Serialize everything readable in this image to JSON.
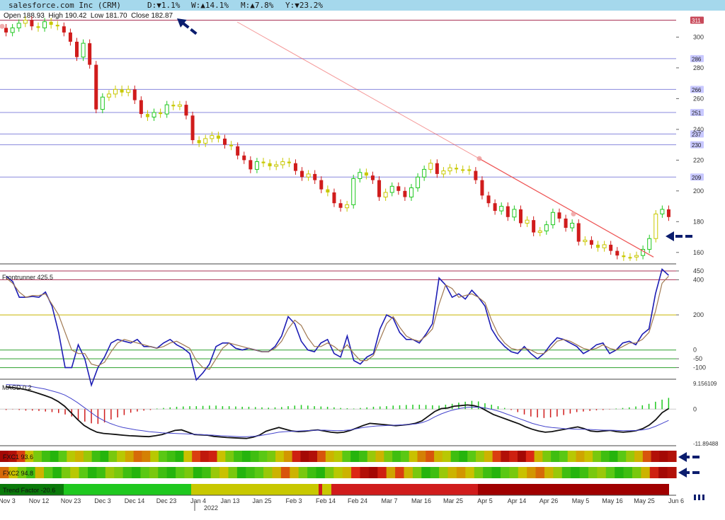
{
  "header": {
    "title": "salesforce.com Inc (CRM)",
    "day": "D:▼1.1%",
    "week": "W:▲14.1%",
    "month": "M:▲7.8%",
    "year": "Y:▼23.2%",
    "ohlc": "Open 188.93  High 190.42  Low 181.70  Close 182.87"
  },
  "colors": {
    "up": "#1fc81f",
    "down": "#d01c1c",
    "neutral": "#c8c800",
    "frontrunner": "#1c1cb4",
    "signal": "#a07850",
    "macd": "#111111",
    "macd_signal": "#4444cc",
    "level_line": "#8888dd",
    "trend_line": "#ee5555"
  },
  "chart_data": [
    {
      "type": "candlestick",
      "title": "salesforce.com Inc (CRM)",
      "x_ticks": [
        "Nov 3",
        "Nov 12",
        "Nov 23",
        "Dec 3",
        "Dec 14",
        "Dec 23",
        "Jan 4",
        "Jan 13",
        "Jan 25",
        "Feb 3",
        "Feb 14",
        "Feb 24",
        "Mar 7",
        "Mar 16",
        "Mar 25",
        "Apr 5",
        "Apr 14",
        "Apr 26",
        "May 5",
        "May 16",
        "May 25",
        "Jun 6"
      ],
      "year_label": "2022",
      "y_ticks": [
        160,
        180,
        200,
        220,
        240,
        260,
        280,
        300
      ],
      "level_labels": [
        311,
        286,
        266,
        251,
        237,
        230,
        209
      ],
      "ylim": [
        153,
        314
      ],
      "close": [
        303,
        306,
        309,
        311,
        307,
        306,
        310,
        308,
        307,
        303,
        297,
        287,
        296,
        282,
        253,
        261,
        263,
        266,
        264,
        266,
        259,
        250,
        248,
        251,
        250,
        256,
        255,
        256,
        249,
        233,
        231,
        234,
        236,
        234,
        230,
        229,
        223,
        220,
        214,
        219,
        218,
        216,
        217,
        219,
        218,
        213,
        209,
        211,
        207,
        201,
        199,
        192,
        189,
        191,
        208,
        212,
        210,
        207,
        196,
        199,
        203,
        200,
        196,
        202,
        209,
        214,
        218,
        211,
        213,
        215,
        214,
        214,
        213,
        207,
        197,
        192,
        187,
        190,
        183,
        188,
        179,
        181,
        173,
        174,
        178,
        186,
        182,
        176,
        179,
        167,
        168,
        165,
        163,
        165,
        161,
        158,
        157,
        157,
        158,
        162,
        169,
        185,
        188,
        183
      ],
      "up_color_count": [
        2,
        4,
        6,
        7
      ],
      "trend_line_from": [
        311,
        "Nov 3"
      ],
      "trend_line_to": [
        157,
        "Jun 1"
      ]
    },
    {
      "type": "line",
      "title": "Frontrunner 425.5",
      "y_ticks": [
        450,
        400,
        200,
        -50,
        -100
      ],
      "ylim": [
        -150,
        470
      ],
      "series": [
        {
          "name": "Frontrunner",
          "values": [
            420,
            390,
            300,
            300,
            305,
            300,
            330,
            250,
            100,
            -100,
            -100,
            30,
            -50,
            -200,
            -100,
            -40,
            40,
            60,
            50,
            40,
            60,
            20,
            20,
            10,
            40,
            60,
            30,
            10,
            -20,
            -170,
            -130,
            -80,
            20,
            40,
            40,
            10,
            0,
            10,
            0,
            -10,
            -10,
            20,
            80,
            190,
            150,
            50,
            0,
            -10,
            40,
            60,
            -20,
            -40,
            80,
            -60,
            -80,
            -40,
            -20,
            120,
            200,
            180,
            100,
            60,
            60,
            40,
            90,
            150,
            410,
            370,
            300,
            320,
            290,
            340,
            300,
            250,
            120,
            60,
            20,
            -10,
            -20,
            20,
            -20,
            -50,
            -20,
            30,
            70,
            60,
            40,
            20,
            -20,
            0,
            30,
            40,
            -20,
            0,
            40,
            50,
            30,
            90,
            120,
            320,
            460,
            425
          ],
          "color": "#1c1cb4"
        },
        {
          "name": "Signal",
          "values": [
            410,
            380,
            330,
            300,
            310,
            310,
            320,
            260,
            200,
            100,
            0,
            -20,
            -20,
            -80,
            -90,
            -70,
            -10,
            40,
            60,
            50,
            40,
            30,
            20,
            10,
            20,
            40,
            50,
            30,
            10,
            -60,
            -100,
            -110,
            -50,
            10,
            40,
            30,
            20,
            10,
            0,
            -10,
            -10,
            10,
            50,
            120,
            170,
            140,
            70,
            20,
            20,
            40,
            20,
            -10,
            30,
            -20,
            -60,
            -60,
            -30,
            60,
            150,
            190,
            130,
            80,
            60,
            50,
            80,
            120,
            260,
            370,
            350,
            300,
            310,
            320,
            300,
            270,
            170,
            90,
            40,
            10,
            0,
            10,
            0,
            -20,
            -20,
            10,
            50,
            60,
            50,
            30,
            10,
            0,
            10,
            30,
            10,
            0,
            20,
            40,
            40,
            60,
            100,
            220,
            380,
            420
          ],
          "color": "#a07850"
        }
      ]
    },
    {
      "type": "bar+line",
      "title": "MACD 0.2",
      "y_ticks": [
        "9.156109",
        "0",
        "-11.89488"
      ],
      "ylim": [
        -11.89,
        9.16
      ],
      "histogram": [
        -0.3,
        -0.1,
        -0.3,
        -0.5,
        -0.5,
        -0.6,
        -0.8,
        -1.0,
        -1.3,
        -1.8,
        -2.5,
        -3.5,
        -4.2,
        -4.8,
        -5.0,
        -4.5,
        -3.5,
        -2.8,
        -2.0,
        -1.2,
        -0.8,
        -0.5,
        -0.3,
        0.2,
        0.4,
        0.6,
        0.8,
        0.9,
        1.0,
        1.0,
        1.1,
        1.2,
        1.2,
        1.0,
        1.0,
        0.9,
        0.8,
        0.8,
        0.7,
        0.6,
        0.5,
        0.6,
        0.7,
        1.0,
        1.2,
        1.4,
        1.2,
        1.0,
        0.9,
        0.8,
        0.6,
        0.4,
        0.3,
        0.2,
        0.4,
        0.6,
        0.8,
        0.9,
        1.0,
        1.2,
        1.3,
        1.4,
        1.5,
        1.5,
        1.4,
        1.3,
        1.2,
        1.5,
        1.8,
        2.2,
        2.5,
        2.8,
        2.6,
        2.0,
        1.5,
        1.0,
        0.4,
        -0.3,
        -1.0,
        -1.8,
        -2.5,
        -2.8,
        -3.0,
        -2.8,
        -2.5,
        -2.0,
        -1.5,
        -1.0,
        -0.8,
        -0.6,
        -0.4,
        -0.3,
        -0.1,
        0.2,
        0.4,
        0.6,
        0.9,
        1.3,
        1.8,
        2.5,
        3.2,
        3.8
      ],
      "macd": [
        7.5,
        7.3,
        7.0,
        6.6,
        6.0,
        5.3,
        4.6,
        3.8,
        2.6,
        1.0,
        -1.2,
        -3.5,
        -5.5,
        -6.8,
        -7.8,
        -8.2,
        -8.4,
        -8.6,
        -8.8,
        -9.0,
        -9.1,
        -9.2,
        -9.3,
        -9.0,
        -8.6,
        -7.9,
        -7.2,
        -7.0,
        -7.8,
        -8.6,
        -8.7,
        -8.8,
        -9.2,
        -9.4,
        -9.6,
        -9.7,
        -9.8,
        -9.9,
        -9.5,
        -8.8,
        -7.5,
        -6.8,
        -6.2,
        -6.8,
        -7.4,
        -7.6,
        -7.5,
        -7.2,
        -7.0,
        -7.4,
        -7.8,
        -8.0,
        -7.8,
        -7.2,
        -6.4,
        -5.5,
        -4.8,
        -5.0,
        -5.2,
        -5.4,
        -5.6,
        -5.4,
        -5.2,
        -4.8,
        -4.0,
        -2.4,
        -0.8,
        0.2,
        0.4,
        1.0,
        1.2,
        1.4,
        1.2,
        0.6,
        -0.6,
        -1.8,
        -2.6,
        -3.4,
        -4.2,
        -5.0,
        -6.0,
        -6.8,
        -7.4,
        -7.8,
        -7.6,
        -7.2,
        -6.8,
        -6.4,
        -6.0,
        -6.6,
        -7.4,
        -7.6,
        -7.4,
        -7.2,
        -7.6,
        -7.8,
        -7.6,
        -7.3,
        -6.6,
        -5.4,
        -3.6,
        -1.2,
        0.2
      ],
      "signal": [
        8.3,
        8.2,
        8.1,
        7.9,
        7.6,
        7.2,
        6.8,
        6.2,
        5.6,
        4.8,
        3.6,
        2.2,
        0.6,
        -1.0,
        -2.6,
        -3.8,
        -4.8,
        -5.6,
        -6.2,
        -6.6,
        -7.0,
        -7.3,
        -7.6,
        -7.8,
        -8.0,
        -8.1,
        -8.2,
        -8.3,
        -8.4,
        -8.5,
        -8.6,
        -8.7,
        -8.8,
        -9.0,
        -9.1,
        -9.2,
        -9.3,
        -9.3,
        -9.2,
        -9.0,
        -8.6,
        -8.2,
        -7.8,
        -7.6,
        -7.5,
        -7.4,
        -7.3,
        -7.2,
        -7.1,
        -7.1,
        -7.2,
        -7.3,
        -7.2,
        -7.0,
        -6.6,
        -6.2,
        -5.9,
        -5.7,
        -5.6,
        -5.5,
        -5.4,
        -5.3,
        -5.2,
        -5.0,
        -4.6,
        -3.8,
        -2.6,
        -1.6,
        -0.8,
        -0.2,
        0.3,
        0.6,
        0.7,
        0.6,
        0.3,
        -0.2,
        -0.8,
        -1.6,
        -2.4,
        -3.2,
        -4.0,
        -4.8,
        -5.4,
        -5.9,
        -6.2,
        -6.4,
        -6.6,
        -6.7,
        -6.8,
        -6.8,
        -6.9,
        -7.0,
        -7.1,
        -7.1,
        -7.2,
        -7.3,
        -7.3,
        -7.2,
        -7.0,
        -6.6,
        -5.8,
        -4.8,
        -3.8
      ]
    },
    {
      "type": "heatmap",
      "rows": [
        {
          "name": "FXC1 93.6",
          "values": [
            -0.9,
            -0.8,
            -0.4,
            0.3,
            0.6,
            0.8,
            0.9,
            0.7,
            0.4,
            0.2,
            0.5,
            0.8,
            0.9,
            0.6,
            0.4,
            0.1,
            -0.2,
            -0.1,
            0.4,
            0.7,
            0.8,
            0.9,
            0.3,
            -0.4,
            -0.7,
            -0.6,
            0.3,
            0.6,
            0.8,
            0.9,
            0.8,
            0.7,
            0.6,
            0.3,
            0.0,
            -0.6,
            -0.9,
            -0.8,
            -0.3,
            0.2,
            0.4,
            0.7,
            0.9,
            0.8,
            0.5,
            0.2,
            0.6,
            0.8,
            0.7,
            0.3,
            -0.1,
            -0.3,
            0.2,
            0.4,
            0.8,
            0.9,
            0.7,
            0.5,
            0.2,
            -0.4,
            -0.8,
            -0.6,
            -0.9,
            -0.5,
            0.2,
            0.6,
            0.8,
            0.7,
            0.4,
            0.1,
            0.3,
            0.6,
            0.8,
            0.9,
            0.7,
            0.5,
            0.2,
            -0.3,
            -0.8,
            -0.9,
            -0.8
          ]
        },
        {
          "name": "FXC2 94.8",
          "values": [
            -0.2,
            0.3,
            0.6,
            0.8,
            0.2,
            0.7,
            0.9,
            0.6,
            0.4,
            0.7,
            0.9,
            0.8,
            0.5,
            0.6,
            0.8,
            0.9,
            0.7,
            0.6,
            0.8,
            0.9,
            0.7,
            0.6,
            0.9,
            0.8,
            0.5,
            0.3,
            0.6,
            0.9,
            0.8,
            0.7,
            0.5,
            0.2,
            -0.3,
            0.2,
            0.6,
            0.8,
            0.9,
            0.6,
            0.4,
            0.2,
            -0.5,
            -0.8,
            -0.9,
            -0.6,
            0.1,
            -0.4,
            0.2,
            0.6,
            0.9,
            0.8,
            0.5,
            0.2,
            0.0,
            0.3,
            0.6,
            0.8,
            0.9,
            0.7,
            0.6,
            0.3,
            0.0,
            -0.2,
            0.2,
            0.5,
            0.8,
            0.9,
            0.8,
            0.6,
            0.5,
            0.7,
            0.9,
            0.8,
            0.6,
            0.2,
            -0.6,
            -0.9,
            -0.8
          ]
        },
        {
          "name": "Trend Factor -20.6",
          "segments": [
            [
              "#0a7a0a",
              "Nov 3",
              "Nov 23"
            ],
            [
              "#1fc81f",
              "Nov 23",
              "Jan 4"
            ],
            [
              "#c8c800",
              "Jan 4",
              "Feb 14"
            ],
            [
              "#d01c1c",
              "Feb 14",
              "Feb 17"
            ],
            [
              "#c8c800",
              "Feb 17",
              "Feb 19"
            ],
            [
              "#d01c1c",
              "Feb 19",
              "Apr 5"
            ],
            [
              "#a00000",
              "Apr 5",
              "Jun 6"
            ]
          ]
        }
      ]
    }
  ]
}
